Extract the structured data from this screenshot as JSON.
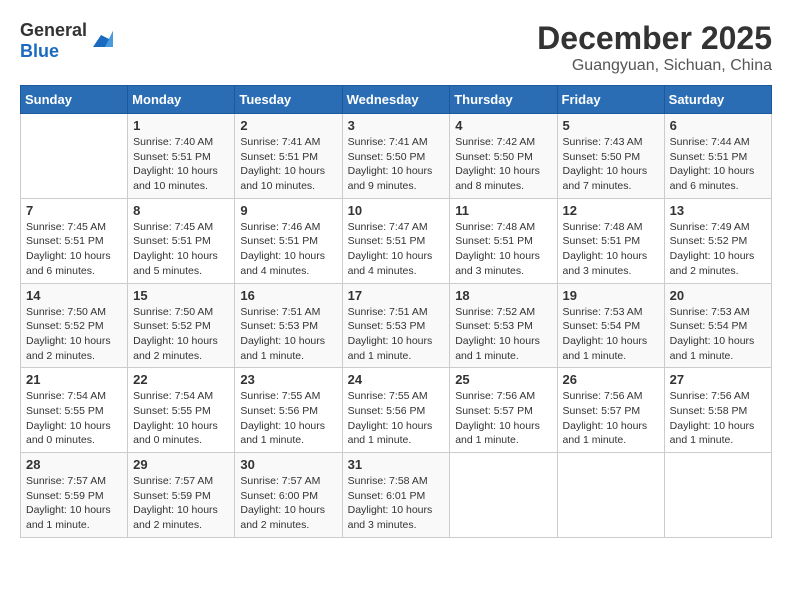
{
  "header": {
    "logo_general": "General",
    "logo_blue": "Blue",
    "month": "December 2025",
    "location": "Guangyuan, Sichuan, China"
  },
  "weekdays": [
    "Sunday",
    "Monday",
    "Tuesday",
    "Wednesday",
    "Thursday",
    "Friday",
    "Saturday"
  ],
  "weeks": [
    [
      {
        "day": "",
        "info": ""
      },
      {
        "day": "1",
        "info": "Sunrise: 7:40 AM\nSunset: 5:51 PM\nDaylight: 10 hours\nand 10 minutes."
      },
      {
        "day": "2",
        "info": "Sunrise: 7:41 AM\nSunset: 5:51 PM\nDaylight: 10 hours\nand 10 minutes."
      },
      {
        "day": "3",
        "info": "Sunrise: 7:41 AM\nSunset: 5:50 PM\nDaylight: 10 hours\nand 9 minutes."
      },
      {
        "day": "4",
        "info": "Sunrise: 7:42 AM\nSunset: 5:50 PM\nDaylight: 10 hours\nand 8 minutes."
      },
      {
        "day": "5",
        "info": "Sunrise: 7:43 AM\nSunset: 5:50 PM\nDaylight: 10 hours\nand 7 minutes."
      },
      {
        "day": "6",
        "info": "Sunrise: 7:44 AM\nSunset: 5:51 PM\nDaylight: 10 hours\nand 6 minutes."
      }
    ],
    [
      {
        "day": "7",
        "info": "Sunrise: 7:45 AM\nSunset: 5:51 PM\nDaylight: 10 hours\nand 6 minutes."
      },
      {
        "day": "8",
        "info": "Sunrise: 7:45 AM\nSunset: 5:51 PM\nDaylight: 10 hours\nand 5 minutes."
      },
      {
        "day": "9",
        "info": "Sunrise: 7:46 AM\nSunset: 5:51 PM\nDaylight: 10 hours\nand 4 minutes."
      },
      {
        "day": "10",
        "info": "Sunrise: 7:47 AM\nSunset: 5:51 PM\nDaylight: 10 hours\nand 4 minutes."
      },
      {
        "day": "11",
        "info": "Sunrise: 7:48 AM\nSunset: 5:51 PM\nDaylight: 10 hours\nand 3 minutes."
      },
      {
        "day": "12",
        "info": "Sunrise: 7:48 AM\nSunset: 5:51 PM\nDaylight: 10 hours\nand 3 minutes."
      },
      {
        "day": "13",
        "info": "Sunrise: 7:49 AM\nSunset: 5:52 PM\nDaylight: 10 hours\nand 2 minutes."
      }
    ],
    [
      {
        "day": "14",
        "info": "Sunrise: 7:50 AM\nSunset: 5:52 PM\nDaylight: 10 hours\nand 2 minutes."
      },
      {
        "day": "15",
        "info": "Sunrise: 7:50 AM\nSunset: 5:52 PM\nDaylight: 10 hours\nand 2 minutes."
      },
      {
        "day": "16",
        "info": "Sunrise: 7:51 AM\nSunset: 5:53 PM\nDaylight: 10 hours\nand 1 minute."
      },
      {
        "day": "17",
        "info": "Sunrise: 7:51 AM\nSunset: 5:53 PM\nDaylight: 10 hours\nand 1 minute."
      },
      {
        "day": "18",
        "info": "Sunrise: 7:52 AM\nSunset: 5:53 PM\nDaylight: 10 hours\nand 1 minute."
      },
      {
        "day": "19",
        "info": "Sunrise: 7:53 AM\nSunset: 5:54 PM\nDaylight: 10 hours\nand 1 minute."
      },
      {
        "day": "20",
        "info": "Sunrise: 7:53 AM\nSunset: 5:54 PM\nDaylight: 10 hours\nand 1 minute."
      }
    ],
    [
      {
        "day": "21",
        "info": "Sunrise: 7:54 AM\nSunset: 5:55 PM\nDaylight: 10 hours\nand 0 minutes."
      },
      {
        "day": "22",
        "info": "Sunrise: 7:54 AM\nSunset: 5:55 PM\nDaylight: 10 hours\nand 0 minutes."
      },
      {
        "day": "23",
        "info": "Sunrise: 7:55 AM\nSunset: 5:56 PM\nDaylight: 10 hours\nand 1 minute."
      },
      {
        "day": "24",
        "info": "Sunrise: 7:55 AM\nSunset: 5:56 PM\nDaylight: 10 hours\nand 1 minute."
      },
      {
        "day": "25",
        "info": "Sunrise: 7:56 AM\nSunset: 5:57 PM\nDaylight: 10 hours\nand 1 minute."
      },
      {
        "day": "26",
        "info": "Sunrise: 7:56 AM\nSunset: 5:57 PM\nDaylight: 10 hours\nand 1 minute."
      },
      {
        "day": "27",
        "info": "Sunrise: 7:56 AM\nSunset: 5:58 PM\nDaylight: 10 hours\nand 1 minute."
      }
    ],
    [
      {
        "day": "28",
        "info": "Sunrise: 7:57 AM\nSunset: 5:59 PM\nDaylight: 10 hours\nand 1 minute."
      },
      {
        "day": "29",
        "info": "Sunrise: 7:57 AM\nSunset: 5:59 PM\nDaylight: 10 hours\nand 2 minutes."
      },
      {
        "day": "30",
        "info": "Sunrise: 7:57 AM\nSunset: 6:00 PM\nDaylight: 10 hours\nand 2 minutes."
      },
      {
        "day": "31",
        "info": "Sunrise: 7:58 AM\nSunset: 6:01 PM\nDaylight: 10 hours\nand 3 minutes."
      },
      {
        "day": "",
        "info": ""
      },
      {
        "day": "",
        "info": ""
      },
      {
        "day": "",
        "info": ""
      }
    ]
  ]
}
